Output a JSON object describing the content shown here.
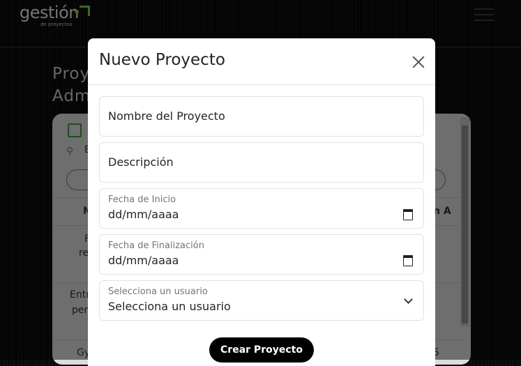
{
  "header": {
    "logo_main": "gestión",
    "logo_sub": "de proyectos"
  },
  "background": {
    "title_line1": "Proy",
    "title_line2": "Adm",
    "search_partial": "B",
    "col_left": "N",
    "col_right": "n A",
    "row1_a": "F",
    "row1_b": "re",
    "row2_a": "Entr",
    "row2_b": "per",
    "row3_a": "Gy",
    "row3_right": "5"
  },
  "modal": {
    "title": "Nuevo Proyecto",
    "fields": {
      "name_placeholder": "Nombre del Proyecto",
      "description_placeholder": "Descripción",
      "start_label": "Fecha de Inicio",
      "start_value": "dd/mm/aaaa",
      "end_label": "Fecha de Finalización",
      "end_value": "dd/mm/aaaa",
      "user_label": "Selecciona un usuario",
      "user_value": "Selecciona un usuario"
    },
    "submit_label": "Crear Proyecto"
  },
  "colors": {
    "accent": "#7fd13b",
    "button": "#000000"
  }
}
